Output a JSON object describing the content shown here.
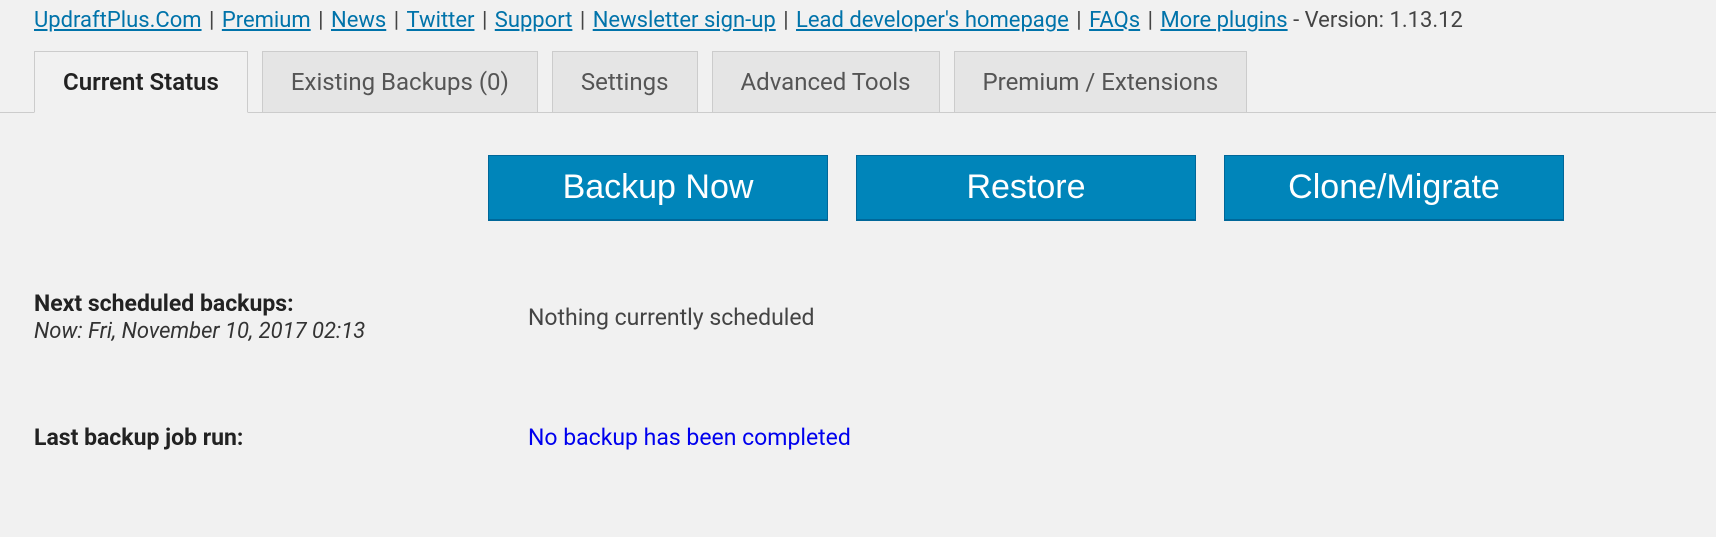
{
  "header": {
    "links": [
      "UpdraftPlus.Com",
      "Premium",
      "News",
      "Twitter",
      "Support",
      "Newsletter sign-up",
      "Lead developer's homepage",
      "FAQs",
      "More plugins"
    ],
    "version_label": " - Version: 1.13.12"
  },
  "tabs": {
    "current_status": "Current Status",
    "existing_backups": "Existing Backups (0)",
    "settings": "Settings",
    "advanced_tools": "Advanced Tools",
    "premium_extensions": "Premium / Extensions"
  },
  "buttons": {
    "backup_now": "Backup Now",
    "restore": "Restore",
    "clone_migrate": "Clone/Migrate"
  },
  "status": {
    "next_scheduled_label": "Next scheduled backups:",
    "now_label": "Now: Fri, November 10, 2017 02:13",
    "next_scheduled_value": "Nothing currently scheduled",
    "last_job_label": "Last backup job run:",
    "last_job_value": "No backup has been completed"
  }
}
